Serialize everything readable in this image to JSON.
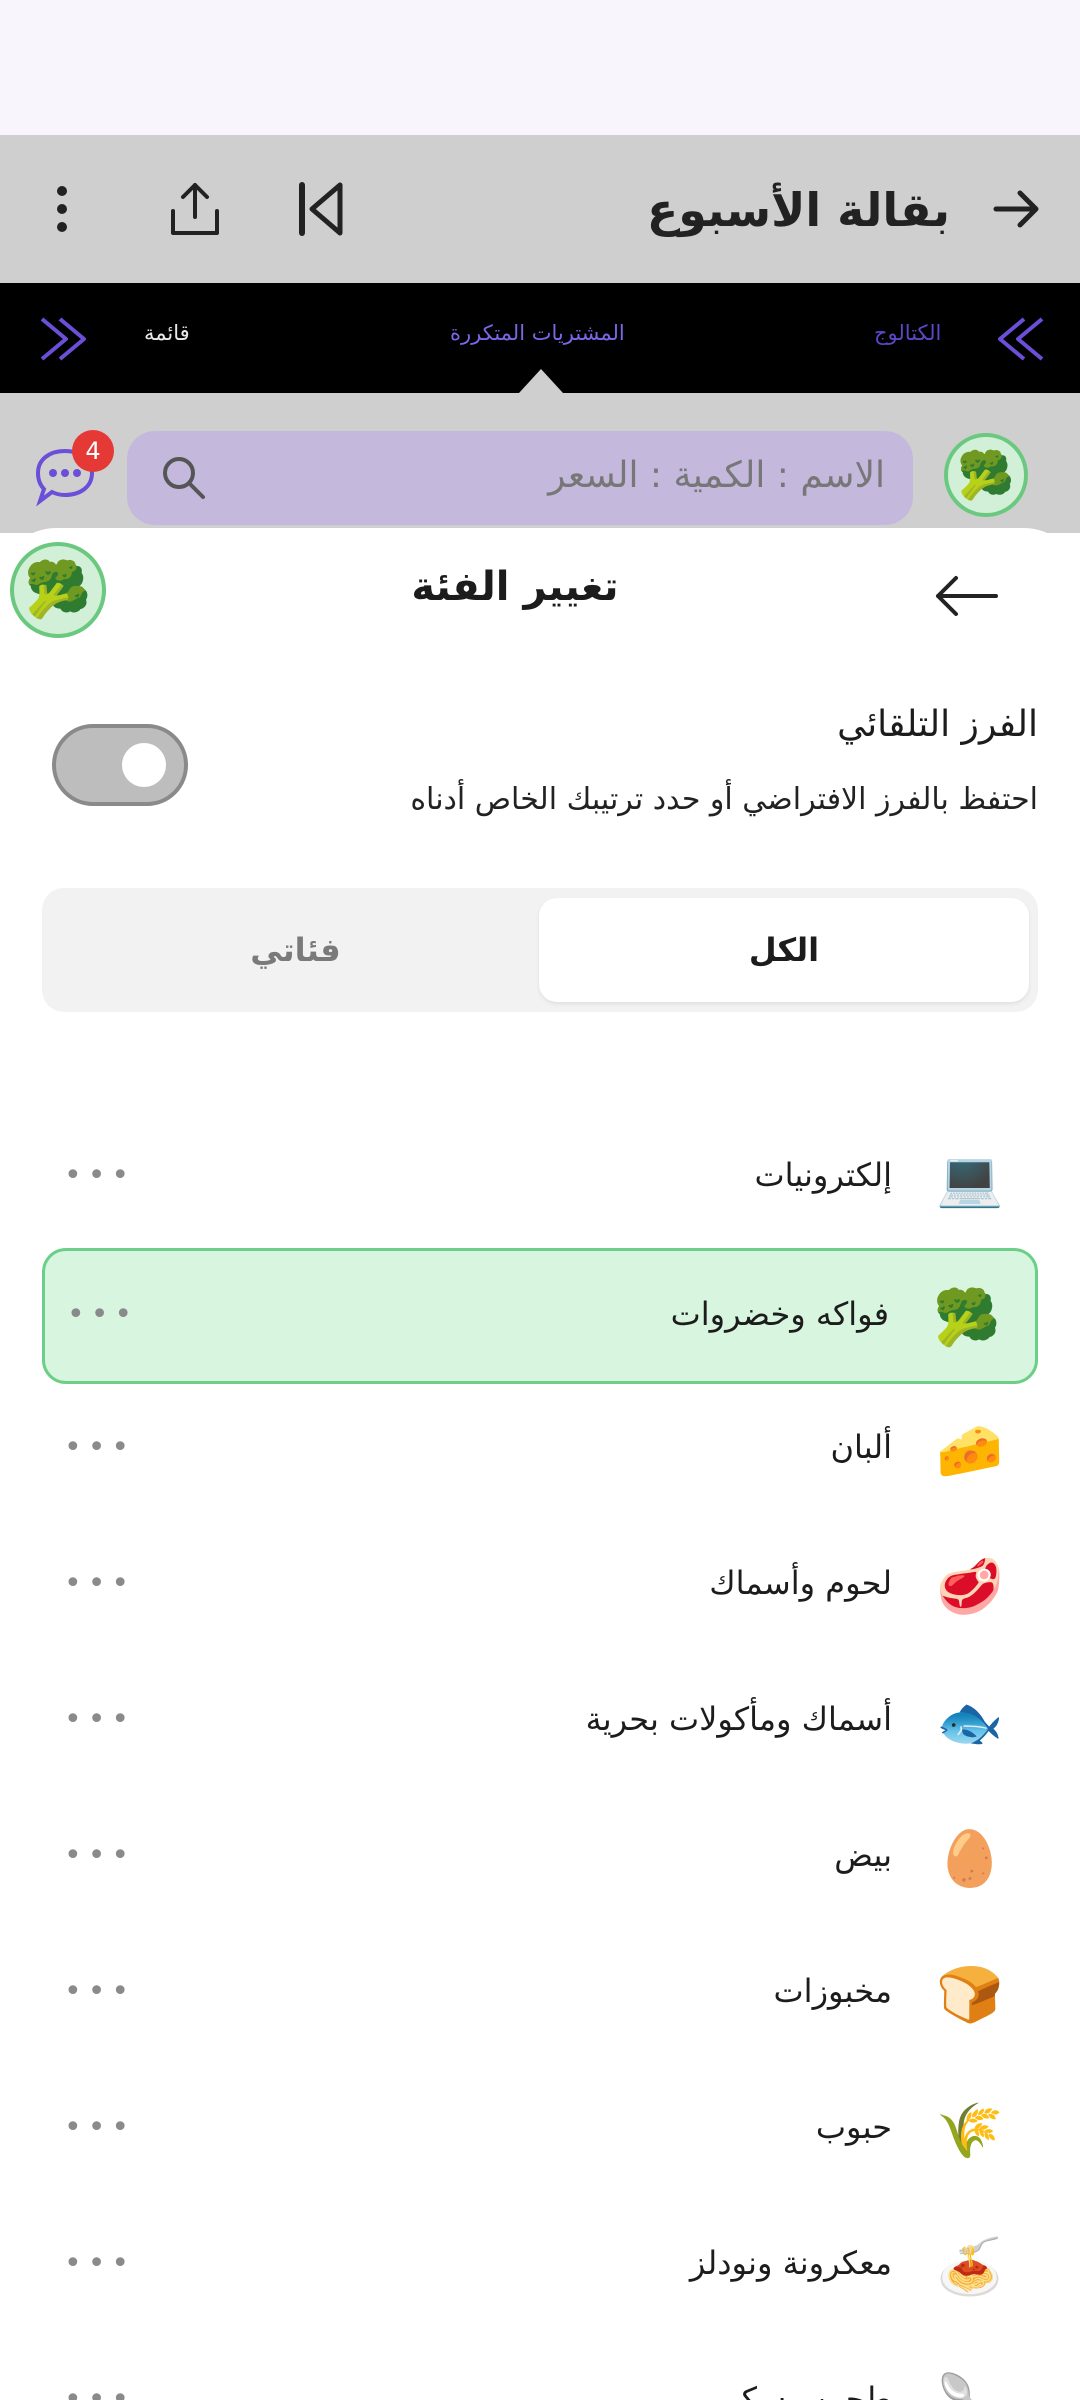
{
  "app_bar": {
    "title": "بقالة الأسبوع"
  },
  "tabs": {
    "left": "قائمة",
    "center": "المشتريات المتكررة",
    "right": "الكتالوج"
  },
  "search": {
    "placeholder": "الاسم : الكمية : السعر",
    "badge_count": "4"
  },
  "sheet": {
    "title": "تغيير الفئة",
    "auto_sort_title": "الفرز التلقائي",
    "auto_sort_description": "احتفظ بالفرز الافتراضي أو حدد ترتيبك الخاص أدناه",
    "segment_all": "الكل",
    "segment_mine": "فئاتي"
  },
  "categories": [
    {
      "label": "إلكترونيات",
      "icon": "💻",
      "selected": false
    },
    {
      "label": "فواكه وخضروات",
      "icon": "🥦",
      "selected": true
    },
    {
      "label": "ألبان",
      "icon": "🧀",
      "selected": false
    },
    {
      "label": "لحوم وأسماك",
      "icon": "🥩",
      "selected": false
    },
    {
      "label": "أسماك ومأكولات بحرية",
      "icon": "🐟",
      "selected": false
    },
    {
      "label": "بيض",
      "icon": "🥚",
      "selected": false
    },
    {
      "label": "مخبوزات",
      "icon": "🍞",
      "selected": false
    },
    {
      "label": "حبوب",
      "icon": "🌾",
      "selected": false
    },
    {
      "label": "معكرونة ونودلز",
      "icon": "🍝",
      "selected": false
    },
    {
      "label": "طحين وسكر",
      "icon": "🥄",
      "selected": false
    }
  ],
  "more_label": "•••",
  "avatar_icon": "🥦"
}
